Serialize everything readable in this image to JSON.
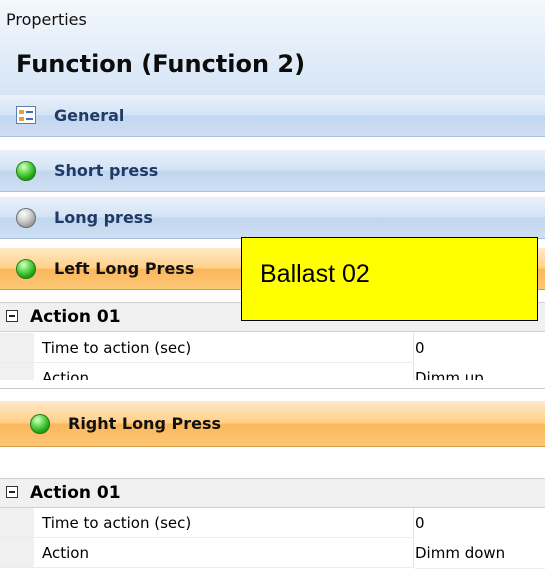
{
  "top_panel": {
    "caption": "Properties",
    "title": "Function (Function 2)",
    "sections": [
      {
        "label": "General",
        "icon": "general-settings-icon"
      },
      {
        "label": "Short press",
        "icon": "green-status-led-icon"
      },
      {
        "label": "Long press",
        "icon": "gray-status-led-icon"
      },
      {
        "label": "Left Long Press",
        "icon": "green-status-led-icon"
      }
    ],
    "action_group": {
      "label": "Action 01",
      "rows": [
        {
          "name": "Time to action (sec)",
          "value": "0"
        },
        {
          "name": "Action",
          "value": "Dimm up"
        }
      ]
    }
  },
  "callout": {
    "text": "Ballast 02",
    "color": "#ffff00"
  },
  "bottom_panel": {
    "section": {
      "label": "Right Long Press",
      "icon": "green-status-led-icon"
    },
    "action_group": {
      "label": "Action 01",
      "rows": [
        {
          "name": "Time to action (sec)",
          "value": "0"
        },
        {
          "name": "Action",
          "value": "Dimm down"
        }
      ]
    }
  },
  "colors": {
    "blue_band": "#d4e3f5",
    "orange_band": "#fbb75a",
    "led_green": "#1ea313",
    "led_gray": "#9a9a9a"
  }
}
